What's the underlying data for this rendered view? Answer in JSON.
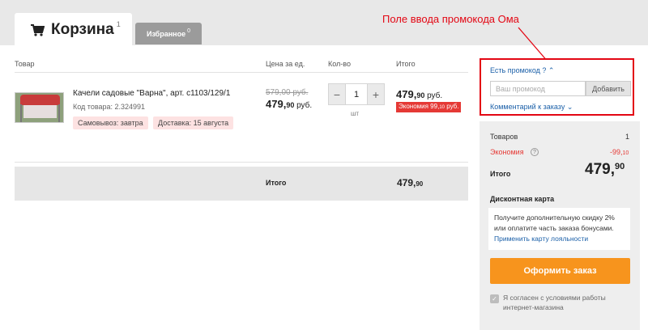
{
  "tabs": {
    "cart": {
      "label": "Корзина",
      "count": "1"
    },
    "favorites": {
      "label": "Избранное",
      "count": "0"
    }
  },
  "annotation": {
    "text": "Поле ввода промокода Ома",
    "color": "#e30613"
  },
  "table": {
    "headers": {
      "product": "Товар",
      "unit_price": "Цена за ед.",
      "quantity": "Кол-во",
      "total": "Итого"
    }
  },
  "item": {
    "name": "Качели садовые \"Варна\", арт. с1103/129/1",
    "code": "Код товара: 2.324991",
    "badges": {
      "pickup": "Самовывоз: завтра",
      "delivery": "Доставка: 15 августа"
    },
    "old_price": "579,00 руб.",
    "price": {
      "main": "479,",
      "cents": "90",
      "currency": " руб."
    },
    "quantity": {
      "minus": "−",
      "value": "1",
      "plus": "+",
      "unit": "шт"
    },
    "total": {
      "main": "479,",
      "cents": "90",
      "currency": " руб."
    },
    "saving": {
      "main": "Экономия 99,",
      "cents": "10",
      "currency": " руб."
    }
  },
  "totals_bar": {
    "label": "Итого",
    "main": "479,",
    "cents": "90"
  },
  "promo": {
    "toggle": "Есть промокод ?",
    "placeholder": "Ваш промокод",
    "apply": "Добавить",
    "comment": "Комментарий к заказу"
  },
  "summary": {
    "items_label": "Товаров",
    "items_value": "1",
    "savings_label": "Экономия",
    "savings_info": "?",
    "savings_main": "-99,",
    "savings_cents": "10",
    "total_label": "Итого",
    "total_main": "479,",
    "total_cents": "90",
    "card_title": "Дисконтная карта",
    "card_text": "Получите дополнительную скидку 2% или оплатите часть заказа бонусами.",
    "card_link": "Применить карту лояльности",
    "checkout": "Оформить заказ",
    "agree_mark": "✓",
    "agree_text": "Я согласен с условиями работы интернет-магазина"
  },
  "colors": {
    "accent_orange": "#f7941d",
    "link_blue": "#1a5fa8",
    "alert_red": "#e53935"
  },
  "icons": {
    "cart": "cart-icon",
    "chevron_up": "chevron-up-icon",
    "chevron_down": "chevron-down-icon"
  }
}
